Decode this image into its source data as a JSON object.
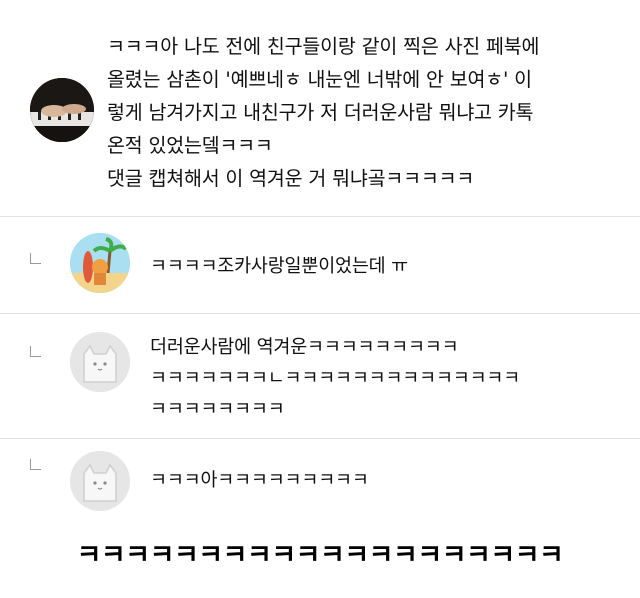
{
  "post": {
    "lines": [
      "ㅋㅋㅋ아 나도 전에 친구들이랑 같이 찍은 사진 페북에",
      "올렸는 삼촌이 '예쁘네ㅎ 내눈엔 너밖에 안 보여ㅎ' 이",
      "렇게 남겨가지고 내친구가 저 더러운사람 뭐냐고 카톡",
      "온적 있었는뎈ㅋㅋㅋ",
      "댓글 캡쳐해서 이 역겨운 거 뭐냐곸ㅋㅋㅋㅋㅋ"
    ]
  },
  "replies": [
    {
      "lines": [
        "ㅋㅋㅋㅋ조카사랑일뿐이었는데 ㅠ"
      ]
    },
    {
      "lines": [
        "더러운사람에 역겨운ㅋㅋㅋㅋㅋㅋㅋㅋㅋ",
        "ㅋㅋㅋㅋㅋㅋㅋㄴㅋㅋㅋㅋㅋㅋㅋㅋㅋㅋㅋㅋㅋㅋ",
        "ㅋㅋㅋㅋㅋㅋㅋㅋ"
      ]
    },
    {
      "lines": [
        "ㅋㅋㅋ아ㅋㅋㅋㅋㅋㅋㅋㅋㅋ"
      ]
    }
  ],
  "caption": "ㅋㅋㅋㅋㅋㅋㅋㅋㅋㅋㅋㅋㅋㅋㅋㅋㅋㅋㅋㅋ"
}
